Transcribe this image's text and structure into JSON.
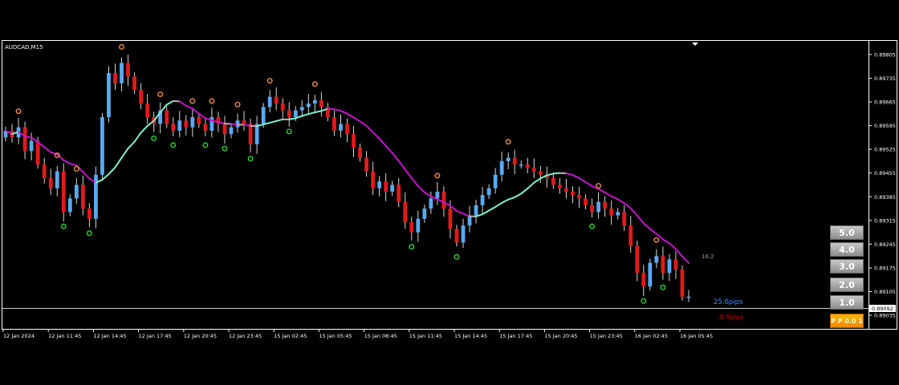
{
  "window": {
    "symbol_label": "AUDCAD,M15"
  },
  "pips": {
    "upper": "25.6pips",
    "upper_color": "#3d8cff",
    "lower": "-0.9pips",
    "lower_color": "#e00000",
    "side_value": "16.2"
  },
  "buttons": {
    "b5": "5.0",
    "b4": "4.0",
    "b3": "3.0",
    "b2": "2.0",
    "b1": "1.0",
    "go": "P P 0.0 1"
  },
  "current_price_tag": "0.89092",
  "colors": {
    "up_candle": "#5aa9f0",
    "down_candle": "#e21a1a",
    "ma_down": "#c214c8",
    "ma_up": "#7ff0d0",
    "ma_flat": "#b6b6b6",
    "buy_signal": "#29d329",
    "sell_signal": "#f08c3c",
    "grid": "#ffffff"
  },
  "chart_data": {
    "type": "candlestick",
    "symbol": "AUDCAD",
    "timeframe": "M15",
    "ylim": [
      0.88995,
      0.89845
    ],
    "y_ticks": [
      "0.89805",
      "0.89735",
      "0.89665",
      "0.89595",
      "0.89525",
      "0.89455",
      "0.89385",
      "0.89315",
      "0.89245",
      "0.89175",
      "0.89105",
      "0.89035"
    ],
    "x_ticks": [
      "12 Jan 2024",
      "12 Jan 11:45",
      "12 Jan 14:45",
      "12 Jan 17:45",
      "12 Jan 20:45",
      "12 Jan 23:45",
      "15 Jan 02:45",
      "15 Jan 05:45",
      "15 Jan 08:45",
      "15 Jan 11:45",
      "15 Jan 14:45",
      "15 Jan 17:45",
      "15 Jan 20:45",
      "15 Jan 23:45",
      "16 Jan 02:45",
      "16 Jan 05:45"
    ],
    "close_series": [
      0.8958,
      0.8956,
      0.8959,
      0.8952,
      0.8955,
      0.8948,
      0.8944,
      0.8941,
      0.8946,
      0.8934,
      0.8938,
      0.8942,
      0.8935,
      0.8932,
      0.8945,
      0.8962,
      0.8975,
      0.8972,
      0.8978,
      0.8974,
      0.897,
      0.8966,
      0.8962,
      0.896,
      0.8964,
      0.896,
      0.8958,
      0.8961,
      0.8959,
      0.8962,
      0.896,
      0.8958,
      0.8962,
      0.896,
      0.8957,
      0.8959,
      0.8961,
      0.896,
      0.8954,
      0.896,
      0.8965,
      0.8968,
      0.8966,
      0.8964,
      0.8962,
      0.8964,
      0.8965,
      0.8966,
      0.8967,
      0.8965,
      0.8962,
      0.8958,
      0.896,
      0.8957,
      0.8953,
      0.895,
      0.8946,
      0.8941,
      0.8943,
      0.894,
      0.8942,
      0.8937,
      0.8931,
      0.8928,
      0.8932,
      0.8935,
      0.8938,
      0.894,
      0.8935,
      0.8929,
      0.8925,
      0.893,
      0.8933,
      0.8936,
      0.8939,
      0.8941,
      0.8945,
      0.8949,
      0.895,
      0.8948,
      0.8948,
      0.8947,
      0.8946,
      0.8945,
      0.8944,
      0.8942,
      0.8941,
      0.894,
      0.8939,
      0.8938,
      0.8936,
      0.8934,
      0.8937,
      0.8935,
      0.8933,
      0.8934,
      0.893,
      0.8924,
      0.8916,
      0.8912,
      0.8919,
      0.8921,
      0.8916,
      0.892,
      0.8917,
      0.8909,
      0.8909
    ],
    "annotations": [
      "16.2",
      "25.6pips",
      "-0.9pips"
    ]
  }
}
